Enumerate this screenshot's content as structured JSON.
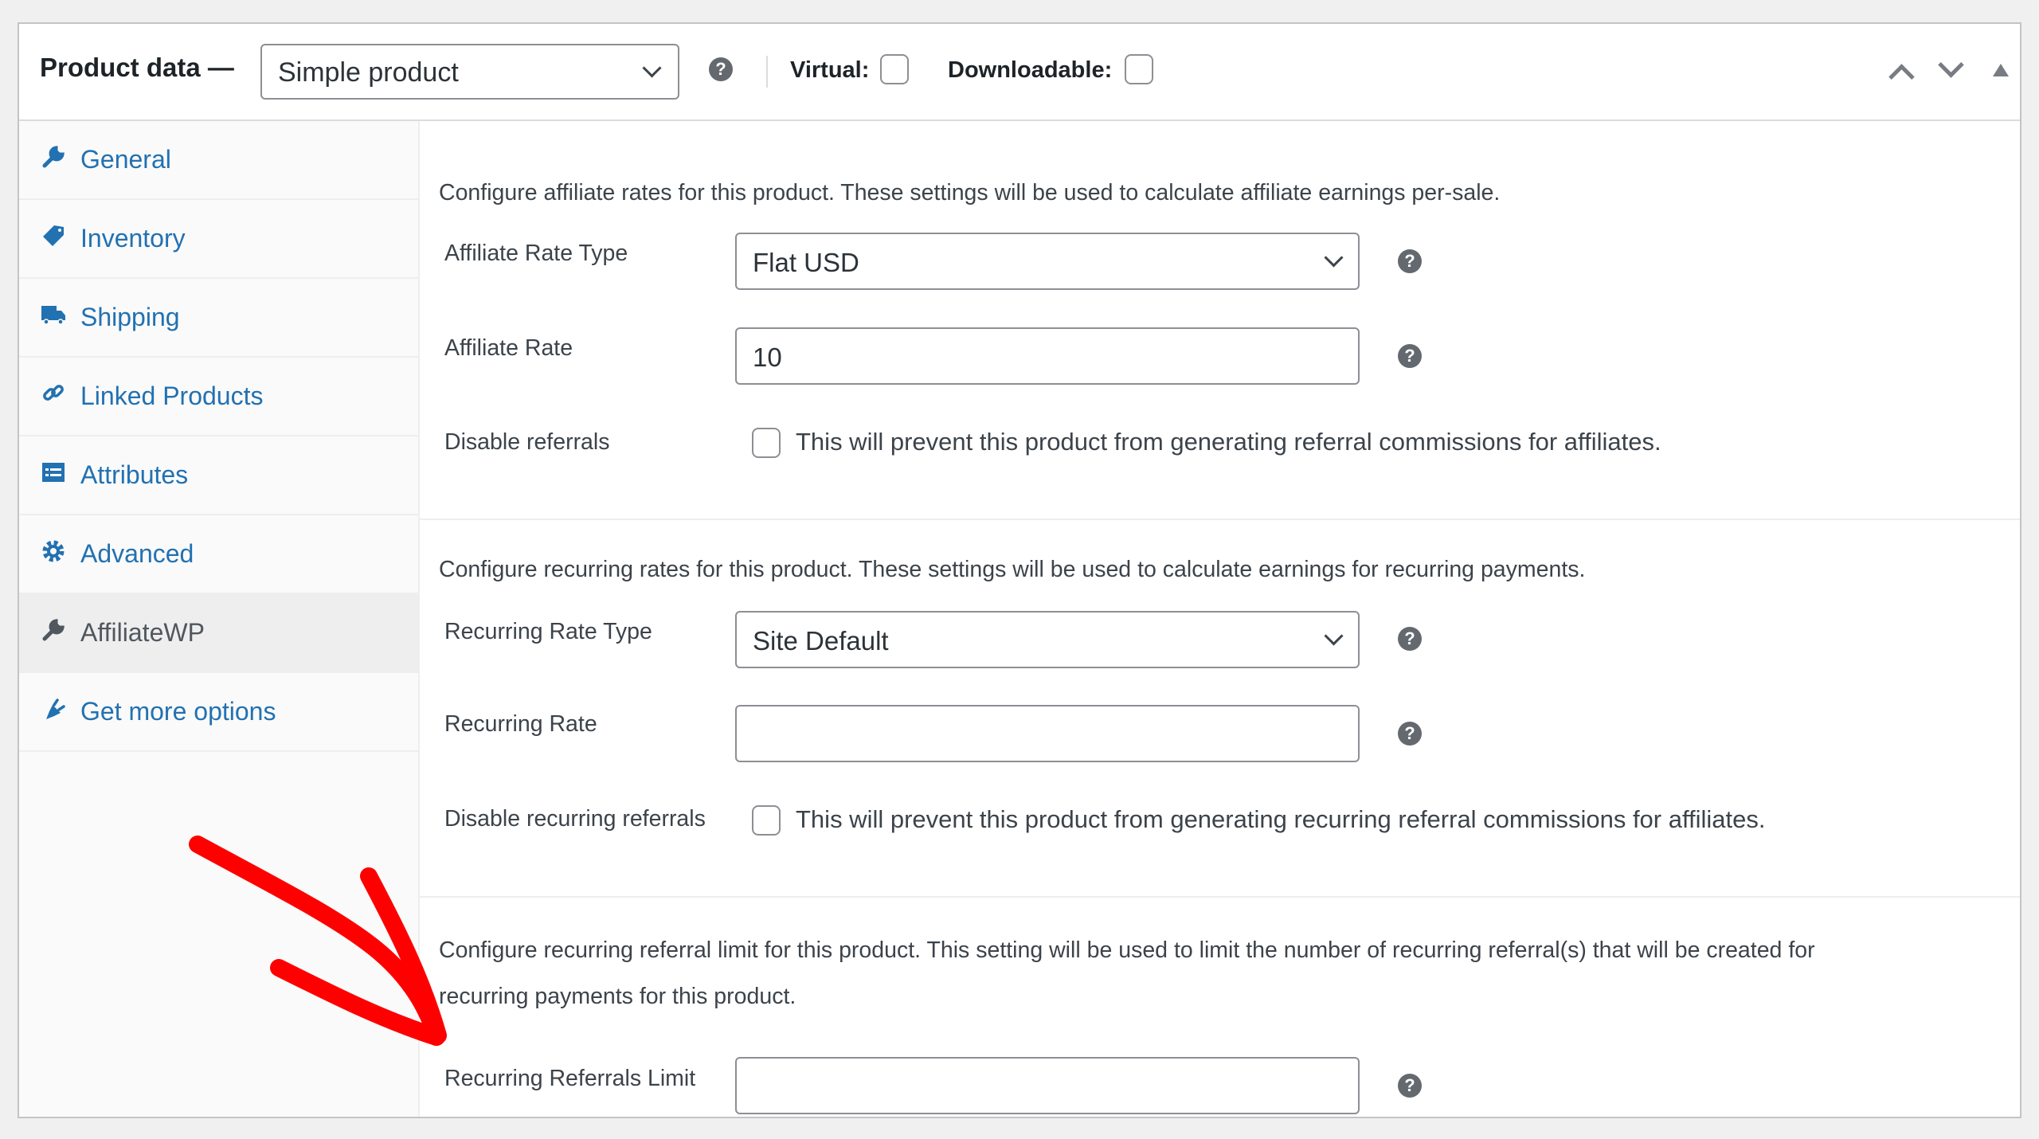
{
  "header": {
    "title": "Product data —",
    "product_type": "Simple product",
    "virtual_label": "Virtual:",
    "virtual_checked": false,
    "downloadable_label": "Downloadable:",
    "downloadable_checked": false,
    "help": "?"
  },
  "sidebar": {
    "items": [
      {
        "label": "General",
        "icon": "wrench-icon",
        "active": false
      },
      {
        "label": "Inventory",
        "icon": "tag-icon",
        "active": false
      },
      {
        "label": "Shipping",
        "icon": "truck-icon",
        "active": false
      },
      {
        "label": "Linked Products",
        "icon": "link-icon",
        "active": false
      },
      {
        "label": "Attributes",
        "icon": "list-table-icon",
        "active": false
      },
      {
        "label": "Advanced",
        "icon": "gear-icon",
        "active": false
      },
      {
        "label": "AffiliateWP",
        "icon": "wrench-icon",
        "active": true
      },
      {
        "label": "Get more options",
        "icon": "plug-icon",
        "active": false
      }
    ]
  },
  "affiliate": {
    "description": "Configure affiliate rates for this product. These settings will be used to calculate affiliate earnings per-sale.",
    "rate_type_label": "Affiliate Rate Type",
    "rate_type_value": "Flat USD",
    "rate_label": "Affiliate Rate",
    "rate_value": "10",
    "disable_label": "Disable referrals",
    "disable_checked": false,
    "disable_text": "This will prevent this product from generating referral commissions for affiliates."
  },
  "recurring": {
    "description": "Configure recurring rates for this product. These settings will be used to calculate earnings for recurring payments.",
    "rate_type_label": "Recurring Rate Type",
    "rate_type_value": "Site Default",
    "rate_label": "Recurring Rate",
    "rate_value": "",
    "disable_label": "Disable recurring referrals",
    "disable_checked": false,
    "disable_text": "This will prevent this product from generating recurring referral commissions for affiliates."
  },
  "limit": {
    "description_line1": "Configure recurring referral limit for this product. This setting will be used to limit the number of recurring referral(s) that will be created for",
    "description_line2": "recurring payments for this product.",
    "label": "Recurring Referrals Limit",
    "value": ""
  },
  "annotation": {
    "color": "#ff0000",
    "type": "red-arrow-pointing-to-limit-field"
  },
  "colors": {
    "link": "#2271b1",
    "active_tab_bg": "#eeeeee",
    "help_icon": "#646970"
  }
}
